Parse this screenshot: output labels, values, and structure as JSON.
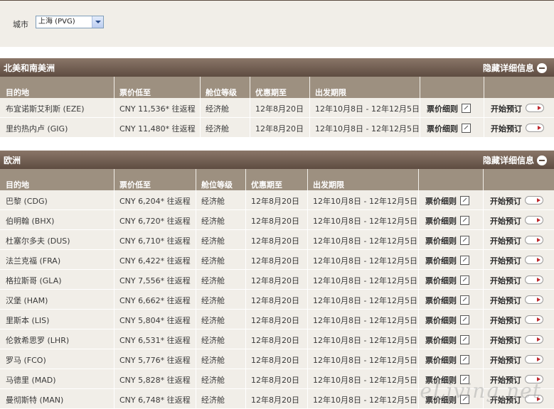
{
  "filter": {
    "label": "城市",
    "selected": "上海 (PVG)"
  },
  "regions": [
    {
      "title": "北美和南美洲",
      "toggle": "隐藏详细信息",
      "headers": [
        "目的地",
        "票价低至",
        "舱位等级",
        "优惠期至",
        "出发期限"
      ],
      "rows": [
        [
          "布宜诺斯艾利斯 (EZE)",
          "CNY 11,536* 往返程",
          "经济舱",
          "12年8月20日",
          "12年10月8日 - 12年12月5日"
        ],
        [
          "里约热内卢 (GIG)",
          "CNY 11,480* 往返程",
          "经济舱",
          "12年8月20日",
          "12年10月8日 - 12年12月5日"
        ]
      ]
    },
    {
      "title": "欧洲",
      "toggle": "隐藏详细信息",
      "headers": [
        "目的地",
        "票价低至",
        "舱位等级",
        "优惠期至",
        "出发期限"
      ],
      "rows": [
        [
          "巴黎 (CDG)",
          "CNY 6,204* 往返程",
          "经济舱",
          "12年8月20日",
          "12年10月8日 - 12年12月5日"
        ],
        [
          "伯明翰 (BHX)",
          "CNY 6,720* 往返程",
          "经济舱",
          "12年8月20日",
          "12年10月8日 - 12年12月5日"
        ],
        [
          "杜塞尔多夫 (DUS)",
          "CNY 6,710* 往返程",
          "经济舱",
          "12年8月20日",
          "12年10月8日 - 12年12月5日"
        ],
        [
          "法兰克福 (FRA)",
          "CNY 6,422* 往返程",
          "经济舱",
          "12年8月20日",
          "12年10月8日 - 12年12月5日"
        ],
        [
          "格拉斯哥 (GLA)",
          "CNY 7,556* 往返程",
          "经济舱",
          "12年8月20日",
          "12年10月8日 - 12年12月5日"
        ],
        [
          "汉堡 (HAM)",
          "CNY 6,662* 往返程",
          "经济舱",
          "12年8月20日",
          "12年10月8日 - 12年12月5日"
        ],
        [
          "里斯本 (LIS)",
          "CNY 5,804* 往返程",
          "经济舱",
          "12年8月20日",
          "12年10月8日 - 12年12月5日"
        ],
        [
          "伦敦希思罗 (LHR)",
          "CNY 6,531* 往返程",
          "经济舱",
          "12年8月20日",
          "12年10月8日 - 12年12月5日"
        ],
        [
          "罗马 (FCO)",
          "CNY 5,776* 往返程",
          "经济舱",
          "12年8月20日",
          "12年10月8日 - 12年12月5日"
        ],
        [
          "马德里 (MAD)",
          "CNY 5,828* 往返程",
          "经济舱",
          "12年8月20日",
          "12年10月8日 - 12年12月5日"
        ],
        [
          "曼彻斯特 (MAN)",
          "CNY 6,748* 往返程",
          "经济舱",
          "12年8月20日",
          "12年10月8日 - 12年12月5日"
        ]
      ]
    }
  ],
  "labels": {
    "rules": "票价细则",
    "book": "开始预订"
  },
  "watermark": "eLiving.net",
  "icons": {
    "external": "external-link-icon",
    "go": "go-arrow-icon",
    "collapse": "minus-circle-icon",
    "dropdown": "chevron-down-icon"
  },
  "colors": {
    "header_bar": "#6f5d51",
    "column_header": "#9d9080",
    "row_bg": "#f1eee8",
    "accent": "#c0282e"
  }
}
